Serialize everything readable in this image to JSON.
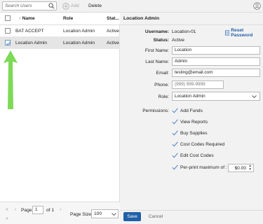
{
  "toolbar": {
    "search_placeholder": "Search Users",
    "add_label": "Add",
    "delete_label": "Delete"
  },
  "grid": {
    "columns": {
      "name": "Name",
      "role": "Role",
      "status": "Stat..."
    },
    "rows": [
      {
        "name": "BAT ACCEPT",
        "role": "Location Admin",
        "status": "Active",
        "checked": false
      },
      {
        "name": "Location Admin",
        "role": "Location Admin",
        "status": "Active",
        "checked": true
      }
    ]
  },
  "pager": {
    "page_label": "Page",
    "page_value": "1",
    "of_label": "of 1",
    "page_size_label": "Page Size:",
    "page_size_value": "100"
  },
  "detail": {
    "title": "Location Admin",
    "username_label": "Username:",
    "username_value": "Location-01",
    "reset_password_label": "Reset Password",
    "status_label": "Status:",
    "status_value": "Active",
    "first_name_label": "First Name:",
    "first_name_value": "Location",
    "last_name_label": "Last Name:",
    "last_name_value": "Admin",
    "email_label": "Email:",
    "email_value": "testing@email.com",
    "phone_label": "Phone:",
    "phone_placeholder": "(999) 999-9999",
    "role_label": "Role:",
    "role_value": "Location Admin",
    "permissions_label": "Permissions:",
    "permissions": [
      "Add Funds",
      "View Reports",
      "Buy Supplies",
      "Cost Codes Required",
      "Edit Cost Codes",
      "Per-print maximum of :"
    ],
    "per_print_value": "$0.00",
    "save_label": "Save",
    "cancel_label": "Cancel"
  },
  "colors": {
    "accent": "#1f5fa8",
    "annotation_arrow": "#7ed957",
    "check": "#4a7fc1"
  },
  "icons": [
    "search-icon",
    "add-icon",
    "user-icon",
    "sort-up-icon",
    "checkmark-icon",
    "key-icon",
    "chevron-down-icon"
  ]
}
